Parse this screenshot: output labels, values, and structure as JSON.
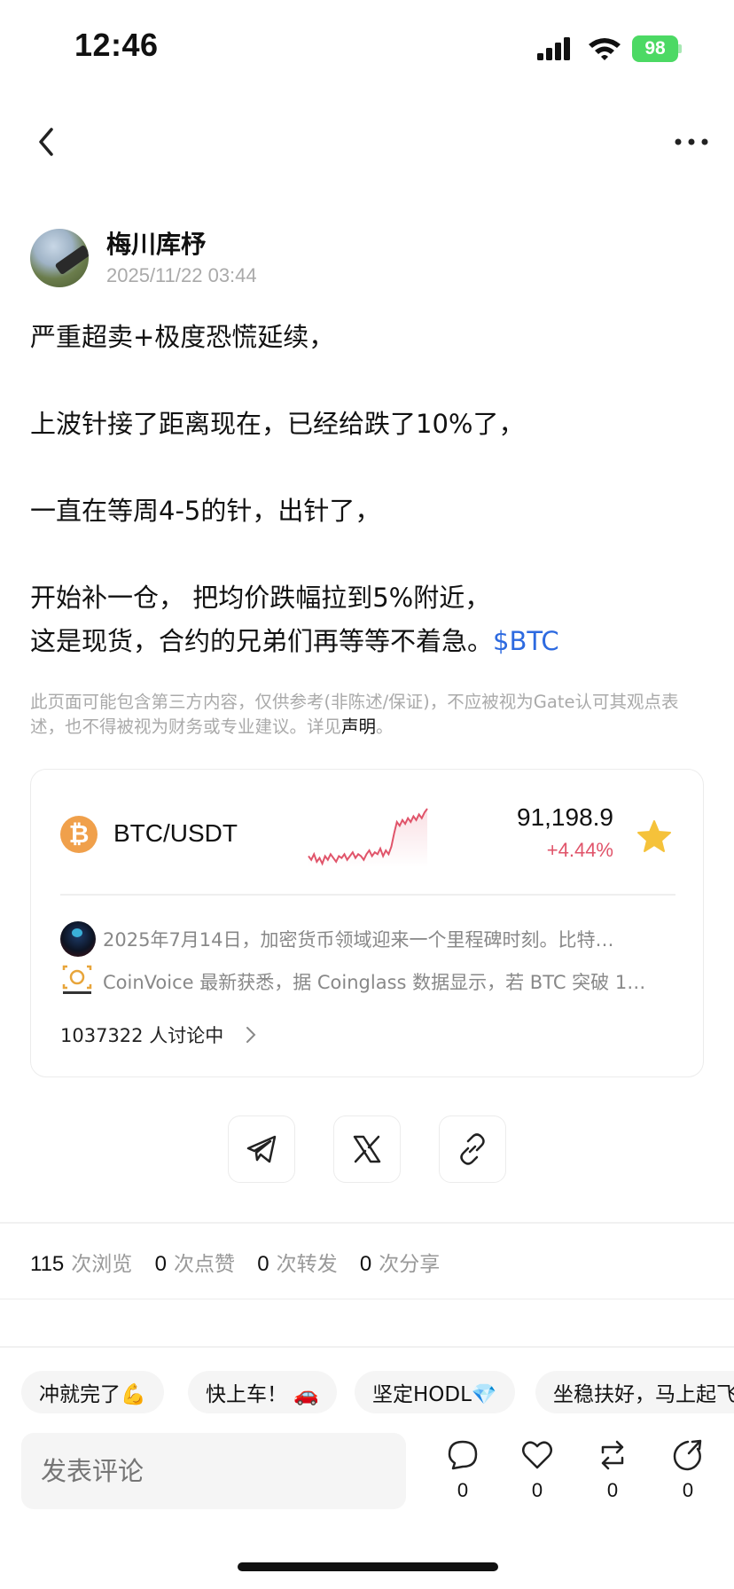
{
  "status_bar": {
    "time": "12:46",
    "battery": "98"
  },
  "post": {
    "author": "梅川库杼",
    "time": "2025/11/22 03:44",
    "lines": [
      "严重超卖+极度恐慌延续，",
      "上波针接了距离现在，已经给跌了10%了，",
      "一直在等周4-5的针，出针了，",
      "开始补一仓， 把均价跌幅拉到5%附近，",
      "这是现货，合约的兄弟们再等等不着急。"
    ],
    "ticker": "$BTC",
    "disclaimer": "此页面可能包含第三方内容，仅供参考(非陈述/保证)，不应被视为Gate认可其观点表述，也不得被视为财务或专业建议。详见",
    "disclaimer_link": "声明",
    "disclaimer_end": "。"
  },
  "market": {
    "icon": "₿",
    "pair": "BTC/USDT",
    "price": "91,198.9",
    "change": "+4.44%",
    "spark_values": [
      30,
      28,
      31,
      27,
      29,
      26,
      30,
      28,
      31,
      29,
      27,
      30,
      29,
      31,
      28,
      30,
      32,
      29,
      31,
      30,
      28,
      31,
      33,
      30,
      32,
      31,
      34,
      30,
      33,
      31,
      35,
      42,
      48,
      46,
      49,
      47,
      50,
      48,
      51,
      49,
      52,
      50,
      53,
      55
    ],
    "news": [
      "2025年7月14日，加密货币领域迎来一个里程碑时刻。比特…",
      "CoinVoice 最新获悉，据 Coinglass 数据显示，若 BTC 突破 1…"
    ],
    "discussion": "1037322 人讨论中"
  },
  "stats": [
    {
      "num": "115",
      "label": "次浏览"
    },
    {
      "num": "0",
      "label": "次点赞"
    },
    {
      "num": "0",
      "label": "次转发"
    },
    {
      "num": "0",
      "label": "次分享"
    }
  ],
  "quick_replies": [
    "冲就完了💪",
    "快上车！ 🚗",
    "坚定HODL💎",
    "坐稳扶好，马上起飞"
  ],
  "comment_placeholder": "发表评论",
  "actions": [
    {
      "icon": "comment-icon",
      "count": "0"
    },
    {
      "icon": "heart-icon",
      "count": "0"
    },
    {
      "icon": "repost-icon",
      "count": "0"
    },
    {
      "icon": "share-icon",
      "count": "0"
    }
  ],
  "colors": {
    "accent": "#2d6ae0",
    "up": "#e0546a",
    "btc": "#f0a04b",
    "star": "#f5c23a"
  }
}
